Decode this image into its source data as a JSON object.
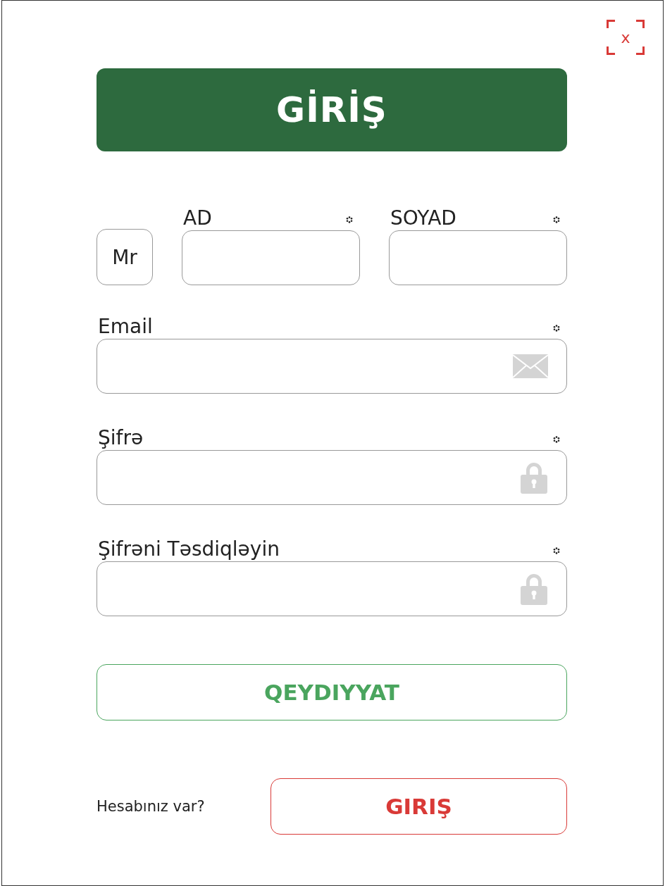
{
  "close": {
    "label": "x"
  },
  "title": "GİRİŞ",
  "salutation": {
    "value": "Mr"
  },
  "name_fields": [
    {
      "label": "AD",
      "required": true
    },
    {
      "label": "SOYAD",
      "required": true
    }
  ],
  "fields": [
    {
      "label": "Email",
      "required": true,
      "kind": "email"
    },
    {
      "label": "Şifrə",
      "required": true,
      "kind": "password"
    },
    {
      "label": "Şifrəni Təsdiqləyin",
      "required": true,
      "kind": "password"
    }
  ],
  "register_button": "QEYDIYYAT",
  "login_prompt": "Hesabınız var?",
  "login_button": "GIRIŞ"
}
